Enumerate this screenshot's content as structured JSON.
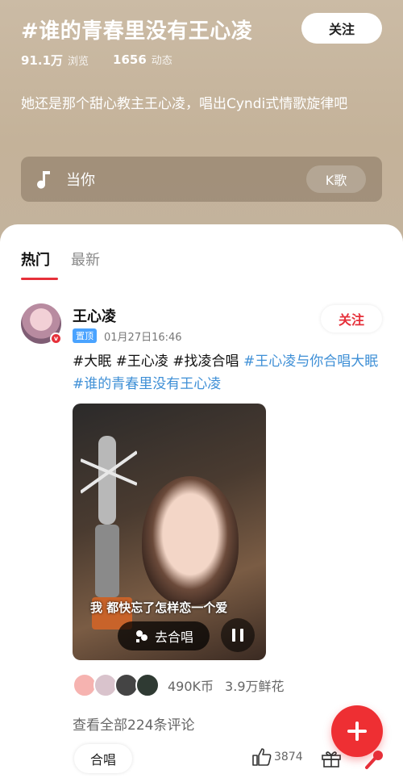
{
  "topic": {
    "title": "#谁的青春里没有王心凌",
    "follow_label": "关注",
    "views_value": "91.1万",
    "views_label": "浏览",
    "posts_value": "1656",
    "posts_label": "动态",
    "description": "她还是那个甜心教主王心凌，唱出Cyndi式情歌旋律吧",
    "song": {
      "name": "当你",
      "k_label": "K歌"
    }
  },
  "tabs": [
    {
      "label": "热门",
      "active": true
    },
    {
      "label": "最新",
      "active": false
    }
  ],
  "post": {
    "user_name": "王心凌",
    "verified_mark": "v",
    "pin_label": "置顶",
    "time": "01月27日16:46",
    "follow_label": "关注",
    "text_plain": "#大眠 #王心凌 #找凌合唱",
    "text_link": "#王心凌与你合唱大眠 #谁的青春里没有王心凌",
    "video": {
      "subtitle": "我 都快忘了怎样恋一个爱",
      "duet_label": "去合唱"
    },
    "gift_coins": "490K币",
    "gift_flowers": "3.9万鲜花",
    "comments_link": "查看全部224条评论",
    "chorus_label": "合唱",
    "like_count": "3874"
  },
  "colors": {
    "accent": "#e6303a",
    "link": "#3e8fd6",
    "pin_tag": "#4aa3ff",
    "fab": "#ee2f33"
  },
  "icons": [
    "music-note-icon",
    "verified-icon",
    "duet-icon",
    "pause-icon",
    "thumb-up-icon",
    "gift-icon",
    "microphone-icon",
    "plus-icon"
  ]
}
